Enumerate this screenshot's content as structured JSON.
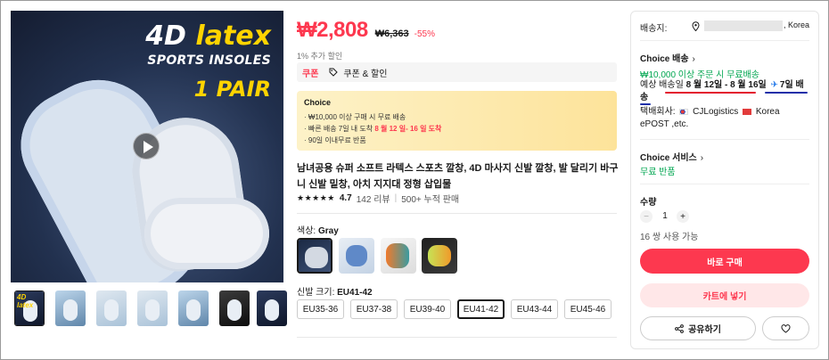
{
  "gallery": {
    "main_image": {
      "headline_1": "4D",
      "headline_2": "latex",
      "headline_3": "SPORTS INSOLES",
      "headline_4": "1 PAIR"
    },
    "play_icon": "play-icon",
    "thumbnail_label": "4D latex",
    "thumbnail_count": 7
  },
  "price": {
    "current": "₩2,808",
    "original": "₩6,363",
    "discount": "-55%",
    "extra_discount": "1% 추가 할인"
  },
  "coupon": {
    "tag": "쿠폰",
    "icon": "tag-icon",
    "label": "쿠폰 & 할인"
  },
  "choice_box": {
    "title": "Choice",
    "line_1": "· ₩10,000 이상 구매 시 무료 배송",
    "line_2_prefix": "· 빠른 배송 7일 내 도착",
    "line_2_highlight": "8 월 12 일- 16 일 도착",
    "line_3": "· 90일 이내무료 반품"
  },
  "product": {
    "title": "남녀공용 슈퍼 소프트 라텍스 스포츠 깔창, 4D 마사지 신발 깔창, 발 달리기 바구니 신발 밑창, 아치 지지대 정형 삽입물",
    "stars": "★★★★★",
    "rating": "4.7",
    "reviews": "142 리뷰",
    "separator": "|",
    "sold": "500+ 누적 판매"
  },
  "color": {
    "label": "색상:",
    "selected": "Gray",
    "swatch_count": 4
  },
  "size": {
    "label": "신발 크기:",
    "selected": "EU41-42",
    "options": [
      "EU35-36",
      "EU37-38",
      "EU39-40",
      "EU41-42",
      "EU43-44",
      "EU45-46"
    ]
  },
  "shipping": {
    "label": "배송지:",
    "country": ", Korea",
    "delivery_title": "Choice 배송",
    "chevron": "›",
    "free_shipping": "₩10,000 이상 주문 시 무료배송",
    "eta_label": "예상 배송일",
    "eta_dates": "8 월 12일 - 8 월 16일",
    "eta_days": "7일 배송",
    "plane_icon": "airplane-icon",
    "carrier_label": "택배회사:",
    "carrier_1": "CJLogistics",
    "carrier_2": "Korea",
    "carrier_3": "ePOST ,etc."
  },
  "service": {
    "title": "Choice 서비스",
    "free_return": "무료 반품"
  },
  "quantity": {
    "label": "수량",
    "minus": "−",
    "value": "1",
    "plus": "+",
    "available": "16 쌍 사용 가능"
  },
  "actions": {
    "buy_now": "바로 구매",
    "add_to_cart": "카트에 넣기",
    "share": "공유하기",
    "share_icon": "share-icon",
    "wishlist_icon": "heart-icon"
  },
  "colors": {
    "accent_red": "#fd384f",
    "free_green": "#00a650",
    "underline_red": "#e3142e",
    "underline_blue": "#1c2fa8"
  }
}
